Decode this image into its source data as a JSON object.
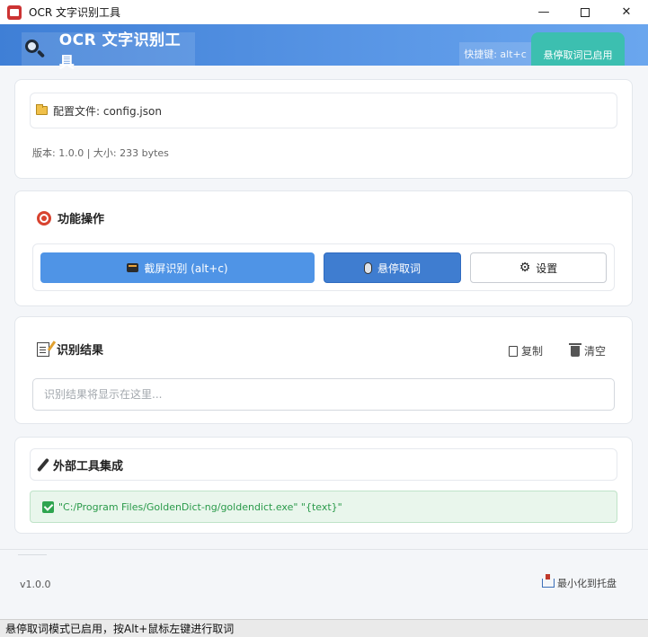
{
  "window": {
    "title": "OCR 文字识别工具",
    "minimize_label": "—",
    "close_label": "✕"
  },
  "header": {
    "title": "OCR 文字识别工具",
    "shortcut_hint": "快捷键: alt+c",
    "status": "悬停取词已启用"
  },
  "config": {
    "file_label": "配置文件: config.json",
    "version_info": "版本: 1.0.0 | 大小: 233 bytes"
  },
  "functions": {
    "title": "功能操作",
    "capture_button": "截屏识别 (alt+c)",
    "hover_button": "悬停取词",
    "settings_button": "设置"
  },
  "result": {
    "title": "识别结果",
    "copy_label": "复制",
    "clear_label": "清空",
    "placeholder": "识别结果将显示在这里...",
    "value": ""
  },
  "external": {
    "title": "外部工具集成",
    "tool_command": "\"C:/Program Files/GoldenDict-ng/goldendict.exe\" \"{text}\""
  },
  "footer": {
    "version": "v1.0.0",
    "tray_button": "最小化到托盘"
  },
  "statusbar": {
    "text": "悬停取词模式已启用，按Alt+鼠标左键进行取词"
  },
  "colors": {
    "header_start": "#3f7fd6",
    "header_end": "#6aa6ee",
    "status_pill": "#3cbfb0",
    "primary_button": "#4f94e6",
    "active_button": "#3f7dd0",
    "success_text": "#2a9a4a"
  },
  "icons": {
    "app": "app-icon",
    "header": "search-icon",
    "config": "folder-icon",
    "functions": "target-icon",
    "capture": "camera-icon",
    "hover": "mouse-icon",
    "settings": "gear-icon",
    "result": "memo-icon",
    "copy": "copy-icon",
    "clear": "trash-icon",
    "external": "pen-icon",
    "tool_status": "check-icon",
    "tray": "tray-icon"
  }
}
